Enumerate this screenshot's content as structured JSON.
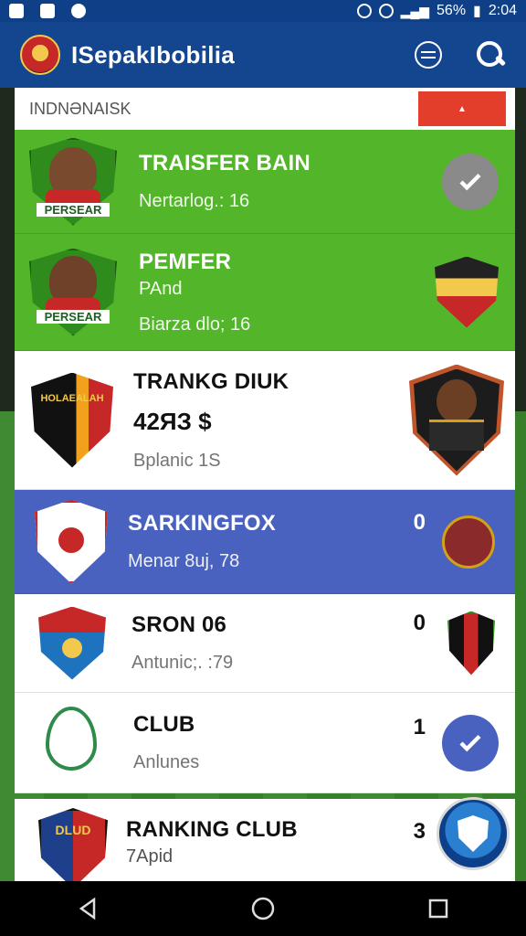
{
  "status_bar": {
    "battery": "56%",
    "time": "2:04"
  },
  "app_bar": {
    "title": "ISepakIbobilia"
  },
  "list_header": {
    "label": "INDNƏNAISK",
    "dropdown_glyph": "▲"
  },
  "rows": [
    {
      "name": "TRAISFER BAIN",
      "sub": "Nertarlog.: 16",
      "badge": "PERSEAR",
      "right_icon": "check-grey"
    },
    {
      "name": "PEMFER",
      "sub": "PAnd",
      "sub2": "Biarza dlo; 16",
      "badge": "PERSEAR",
      "right_icon": "club-crest"
    },
    {
      "name": "TRANKG DIUK",
      "big": "42ЯЗ $",
      "sub2": "Bplanic  1S",
      "crest_text": "HOLAEALAH",
      "right_icon": "player-badge"
    },
    {
      "name": "SARKINGFOX",
      "score": "0",
      "sub": "Menar 8uj, 78",
      "right_icon": "club-crest"
    },
    {
      "name": "SRON 06",
      "score": "0",
      "sub": "Antunic;. :79",
      "right_icon": "club-crest"
    },
    {
      "name": "CLUB",
      "score": "1",
      "sub": "Anlunes",
      "right_icon": "check-blue"
    },
    {
      "name": "RANKING CLUB",
      "score": "3",
      "sub": "7Apid",
      "crest_text": "DLUD",
      "right_icon": "fab"
    }
  ],
  "colors": {
    "appbar": "#13468f",
    "green_row": "#53b52a",
    "blue_row": "#4a62bf",
    "accent_red": "#e33e2b"
  }
}
